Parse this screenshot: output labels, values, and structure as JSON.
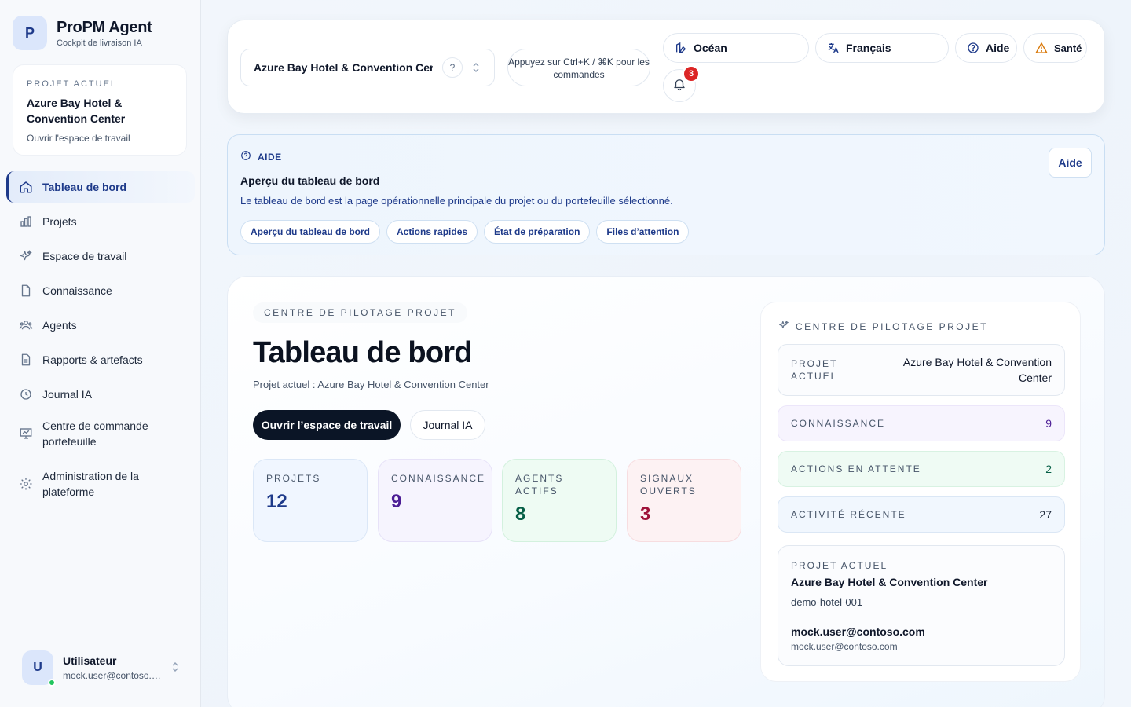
{
  "brand": {
    "logo_letter": "P",
    "title": "ProPM Agent",
    "subtitle": "Cockpit de livraison IA"
  },
  "current_project_card": {
    "eyebrow": "PROJET ACTUEL",
    "name": "Azure Bay Hotel & Convention Center",
    "link": "Ouvrir l'espace de travail"
  },
  "nav": [
    {
      "label": "Tableau de bord",
      "icon": "home-icon",
      "active": true
    },
    {
      "label": "Projets",
      "icon": "bar-chart-icon"
    },
    {
      "label": "Espace de travail",
      "icon": "sparkles-icon"
    },
    {
      "label": "Connaissance",
      "icon": "file-icon"
    },
    {
      "label": "Agents",
      "icon": "users-icon"
    },
    {
      "label": "Rapports & artefacts",
      "icon": "document-icon"
    },
    {
      "label": "Journal IA",
      "icon": "clock-icon"
    },
    {
      "label": "Centre de commande portefeuille",
      "icon": "presentation-chart-icon"
    },
    {
      "label": "Administration de la plateforme",
      "icon": "gear-icon"
    }
  ],
  "user": {
    "initial": "U",
    "name": "Utilisateur",
    "email": "mock.user@contoso.com",
    "status_color": "#22c55e"
  },
  "topbar": {
    "project_select": "Azure Bay Hotel & Convention Cent",
    "command_hint": "Appuyez sur Ctrl+K / ⌘K pour les commandes",
    "theme": "Océan",
    "language": "Français",
    "help": "Aide",
    "health": "Santé",
    "notifications_count": "3"
  },
  "help_panel": {
    "eyebrow": "AIDE",
    "title": "Aperçu du tableau de bord",
    "description": "Le tableau de bord est la page opérationnelle principale du projet ou du portefeuille sélectionné.",
    "chips": [
      "Aperçu du tableau de bord",
      "Actions rapides",
      "État de préparation",
      "Files d’attention"
    ],
    "button": "Aide"
  },
  "main": {
    "eyebrow": "CENTRE DE PILOTAGE PROJET",
    "title": "Tableau de bord",
    "subtitle": "Projet actuel : Azure Bay Hotel & Convention Center",
    "primary_button": "Ouvrir l’espace de travail",
    "secondary_button": "Journal IA",
    "stats": [
      {
        "label": "PROJETS",
        "value": "12",
        "tone": "blue"
      },
      {
        "label": "CONNAISSANCE",
        "value": "9",
        "tone": "purple"
      },
      {
        "label": "AGENTS ACTIFS",
        "value": "8",
        "tone": "green"
      },
      {
        "label": "SIGNAUX OUVERTS",
        "value": "3",
        "tone": "red"
      }
    ]
  },
  "side_card": {
    "eyebrow": "CENTRE DE PILOTAGE PROJET",
    "current_project_label": "PROJET ACTUEL",
    "current_project_value": "Azure Bay Hotel & Convention Center",
    "knowledge_label": "CONNAISSANCE",
    "knowledge_value": "9",
    "pending_label": "ACTIONS EN ATTENTE",
    "pending_value": "2",
    "recent_label": "ACTIVITÉ RÉCENTE",
    "recent_value": "27",
    "info": {
      "label": "PROJET ACTUEL",
      "project_name": "Azure Bay Hotel & Convention Center",
      "project_id": "demo-hotel-001",
      "user_name": "mock.user@contoso.com",
      "user_email": "mock.user@contoso.com"
    }
  },
  "colors": {
    "accent": "#1e3a8a",
    "primary_button": "#0b1526",
    "alert": "#dc2626"
  }
}
